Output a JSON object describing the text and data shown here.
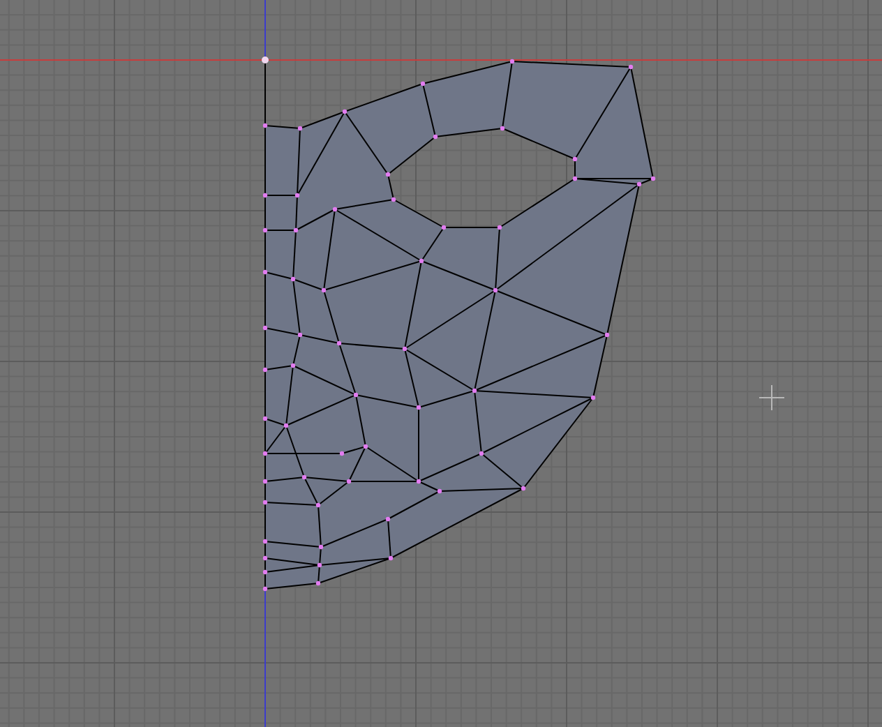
{
  "viewport": {
    "show_grid": true,
    "show_axes": true,
    "show_mesh": true,
    "show_cursor": true
  }
}
